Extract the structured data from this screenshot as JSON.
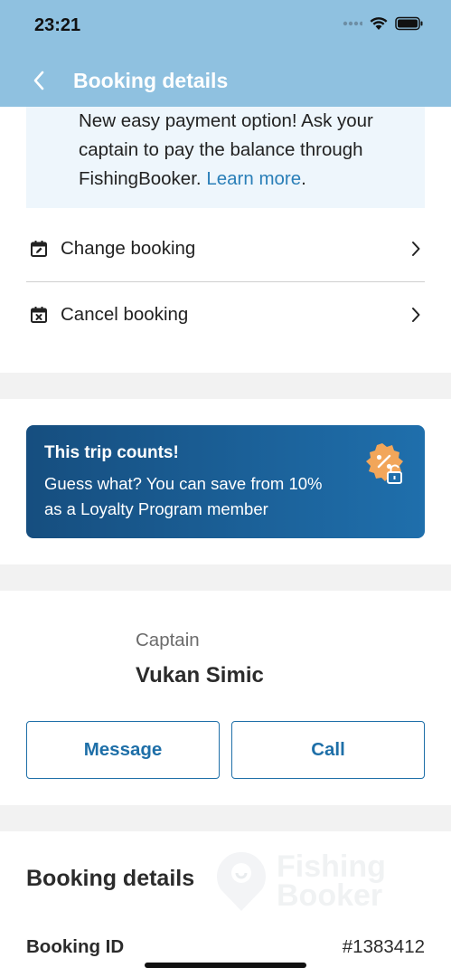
{
  "status_bar": {
    "time": "23:21"
  },
  "nav": {
    "title": "Booking details"
  },
  "notice": {
    "text": "New easy payment option! Ask your captain to pay the balance through FishingBooker.",
    "link": "Learn more",
    "suffix": "."
  },
  "actions": [
    {
      "label": "Change booking",
      "icon": "calendar-edit-icon"
    },
    {
      "label": "Cancel booking",
      "icon": "calendar-cancel-icon"
    }
  ],
  "loyalty": {
    "title": "This trip counts!",
    "text": "Guess what? You can save from 10% as a Loyalty Program member",
    "icon": "discount-badge-lock-icon"
  },
  "captain": {
    "role": "Captain",
    "name": "Vukan Simic",
    "message_label": "Message",
    "call_label": "Call"
  },
  "booking_details": {
    "title": "Booking details",
    "watermark_line1": "Fishing",
    "watermark_line2": "Booker",
    "booking_id_label": "Booking ID",
    "booking_id_value": "#1383412"
  },
  "colors": {
    "header": "#8fc1e0",
    "accent": "#1e6fa8",
    "loyalty_gradient_start": "#164e7f",
    "loyalty_gradient_end": "#1f6fac",
    "badge": "#f2a65a"
  }
}
